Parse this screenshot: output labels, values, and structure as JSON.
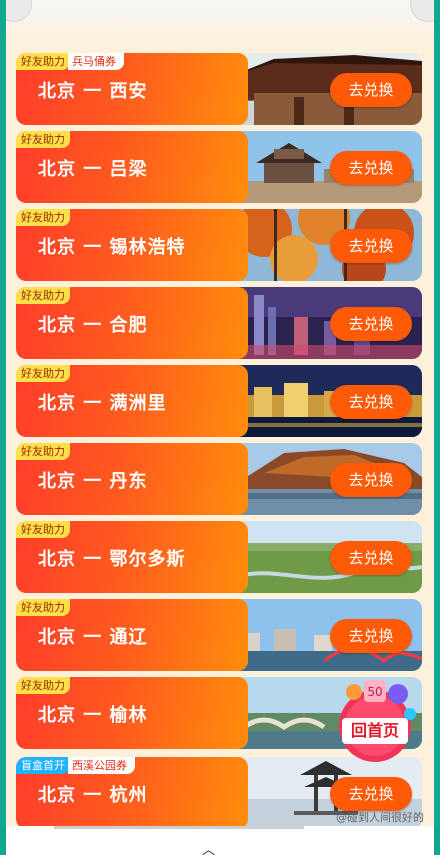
{
  "tickets": [
    {
      "tag": "好友助力",
      "tag_style": "yellow",
      "subtag": "兵马俑券",
      "route": "北京 一 西安",
      "button": "去兑换"
    },
    {
      "tag": "好友助力",
      "tag_style": "yellow",
      "route": "北京 一 吕梁",
      "button": "去兑换"
    },
    {
      "tag": "好友助力",
      "tag_style": "yellow",
      "route": "北京 一 锡林浩特",
      "button": "去兑换"
    },
    {
      "tag": "好友助力",
      "tag_style": "yellow",
      "route": "北京 一 合肥",
      "button": "去兑换"
    },
    {
      "tag": "好友助力",
      "tag_style": "yellow",
      "route": "北京 一 满洲里",
      "button": "去兑换"
    },
    {
      "tag": "好友助力",
      "tag_style": "yellow",
      "route": "北京 一 丹东",
      "button": "去兑换"
    },
    {
      "tag": "好友助力",
      "tag_style": "yellow",
      "route": "北京 一 鄂尔多斯",
      "button": "去兑换"
    },
    {
      "tag": "好友助力",
      "tag_style": "yellow",
      "route": "北京 一 通辽",
      "button": "去兑换"
    },
    {
      "tag": "好友助力",
      "tag_style": "yellow",
      "route": "北京 一 榆林",
      "button": "去兑换"
    },
    {
      "tag": "盲盒首开",
      "tag_style": "blue",
      "subtag": "西溪公园券",
      "route": "北京 一 杭州",
      "button": ""
    }
  ],
  "home_badge": {
    "label": "回首页",
    "number": "50"
  },
  "watermark": "@碰到人间很好的",
  "colors": {
    "accent": "#ff5a08",
    "gradient_start": "#ff3d2b",
    "gradient_end": "#ff8d0c",
    "tag_yellow": "#ffe04a",
    "tag_blue": "#1fb2ff"
  }
}
